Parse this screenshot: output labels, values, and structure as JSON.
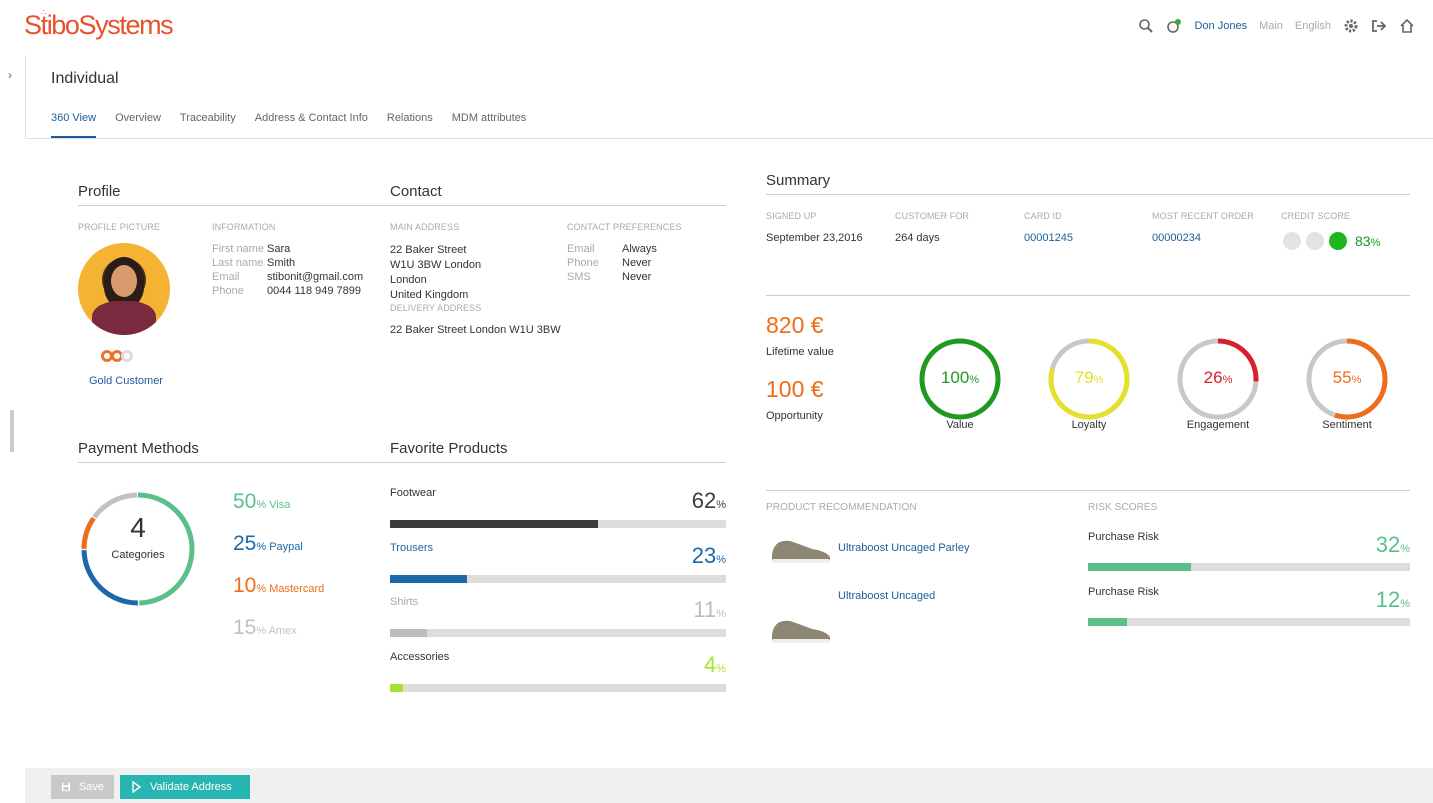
{
  "header": {
    "logo": "StiboSystems",
    "user": "Don Jones",
    "context": "Main",
    "language": "English"
  },
  "page": {
    "title": "Individual",
    "tabs": [
      {
        "label": "360 View",
        "active": true
      },
      {
        "label": "Overview"
      },
      {
        "label": "Traceability"
      },
      {
        "label": "Address & Contact Info"
      },
      {
        "label": "Relations"
      },
      {
        "label": "MDM attributes"
      }
    ]
  },
  "profile": {
    "title": "Profile",
    "picture_label": "PROFILE PICTURE",
    "info_label": "INFORMATION",
    "fields": [
      {
        "label": "First name",
        "value": "Sara"
      },
      {
        "label": "Last name",
        "value": "Smith"
      },
      {
        "label": "Email",
        "value": "stibonit@gmail.com"
      },
      {
        "label": "Phone",
        "value": "0044 118 949 7899"
      }
    ],
    "tier": "Gold Customer",
    "tier_color": "#e8752b"
  },
  "contact": {
    "title": "Contact",
    "main_address_label": "MAIN ADDRESS",
    "main_address": [
      "22 Baker Street",
      "W1U 3BW London",
      "London",
      "United Kingdom"
    ],
    "delivery_label": "DELIVERY ADDRESS",
    "delivery_address": "22 Baker Street London W1U 3BW",
    "pref_label": "CONTACT PREFERENCES",
    "prefs": [
      {
        "label": "Email",
        "value": "Always"
      },
      {
        "label": "Phone",
        "value": "Never"
      },
      {
        "label": "SMS",
        "value": "Never"
      }
    ]
  },
  "summary": {
    "title": "Summary",
    "columns": [
      {
        "label": "SIGNED UP",
        "value": "September 23,2016",
        "link": false
      },
      {
        "label": "CUSTOMER FOR",
        "value": "264 days",
        "link": false
      },
      {
        "label": "CARD ID",
        "value": "00001245",
        "link": true
      },
      {
        "label": "MOST RECENT ORDER",
        "value": "00000234",
        "link": true
      }
    ],
    "credit_label": "CREDIT SCORE",
    "credit_value": "83",
    "credit_unit": "%",
    "credit_level": 3
  },
  "values": {
    "lifetime": "820 €",
    "lifetime_label": "Lifetime value",
    "opportunity": "100 €",
    "opportunity_label": "Opportunity"
  },
  "gauges": [
    {
      "label": "Value",
      "value": 100,
      "text": "100",
      "unit": "%",
      "color": "#1f9a1f"
    },
    {
      "label": "Loyalty",
      "value": 79,
      "text": "79",
      "unit": "%",
      "color": "#e5e02a"
    },
    {
      "label": "Engagement",
      "value": 26,
      "text": "26",
      "unit": "%",
      "color": "#d9202e"
    },
    {
      "label": "Sentiment",
      "value": 55,
      "text": "55",
      "unit": "%",
      "color": "#ee6c1a"
    }
  ],
  "payment": {
    "title": "Payment Methods",
    "center_value": "4",
    "center_label": "Categories",
    "methods": [
      {
        "name": "Visa",
        "value": 50,
        "text": "50",
        "color": "#5bbf8a"
      },
      {
        "name": "Paypal",
        "value": 25,
        "text": "25",
        "color": "#1d68a8"
      },
      {
        "name": "Mastercard",
        "value": 10,
        "text": "10",
        "color": "#ee6c1a"
      },
      {
        "name": "Amex",
        "value": 15,
        "text": "15",
        "color": "#c2c2c2"
      }
    ]
  },
  "favorites": {
    "title": "Favorite Products",
    "items": [
      {
        "name": "Footwear",
        "value": 62,
        "text": "62",
        "color": "#3c3c3c",
        "label_color": "#333"
      },
      {
        "name": "Trousers",
        "value": 23,
        "text": "23",
        "color": "#1d68a8",
        "label_color": "#1d68a8"
      },
      {
        "name": "Shirts",
        "value": 11,
        "text": "11",
        "color": "#bdbdbd",
        "label_color": "#aaa"
      },
      {
        "name": "Accessories",
        "value": 4,
        "text": "4",
        "color": "#a6e22e",
        "label_color": "#333"
      }
    ]
  },
  "recommendation": {
    "title": "PRODUCT RECOMMENDATION",
    "items": [
      "Ultraboost Uncaged Parley",
      "Ultraboost Uncaged"
    ]
  },
  "risk": {
    "title": "RISK SCORES",
    "items": [
      {
        "name": "Purchase Risk",
        "value": 32,
        "text": "32"
      },
      {
        "name": "Purchase Risk",
        "value": 12,
        "text": "12"
      }
    ],
    "color": "#5bbf8a"
  },
  "actions": {
    "save": "Save",
    "validate": "Validate Address"
  }
}
